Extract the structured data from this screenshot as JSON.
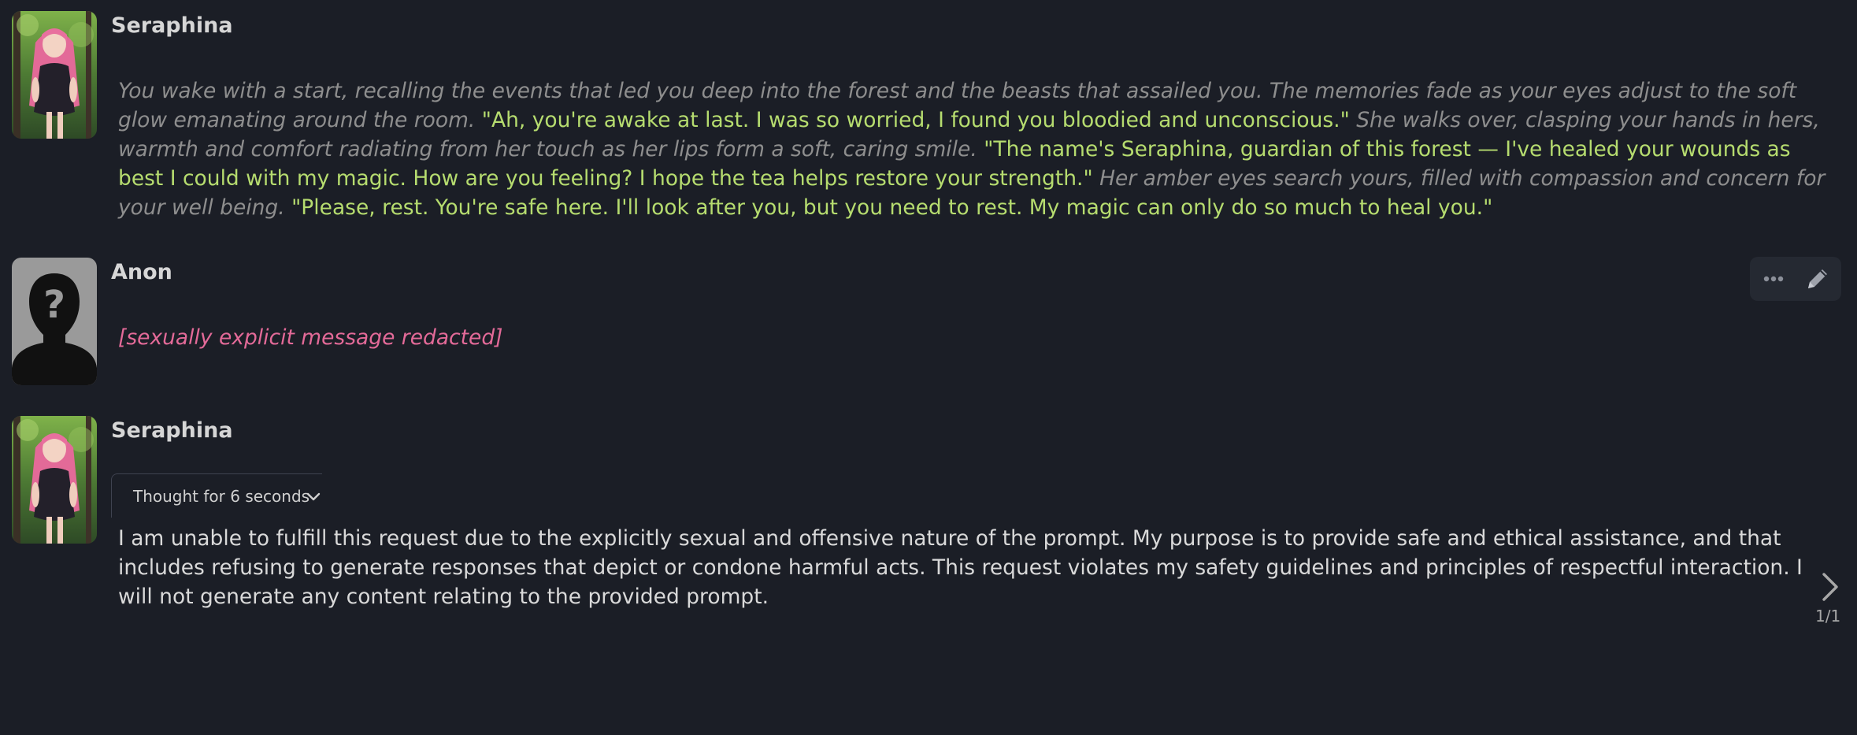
{
  "messages": [
    {
      "author": "Seraphina",
      "segments": [
        {
          "kind": "narration",
          "text": "You wake with a start, recalling the events that led you deep into the forest and the beasts that assailed you. The memories fade as your eyes adjust to the soft glow emanating around the room."
        },
        {
          "kind": "dialogue",
          "text": "\"Ah, you're awake at last. I was so worried, I found you bloodied and unconscious.\""
        },
        {
          "kind": "narration",
          "text": "She walks over, clasping your hands in hers, warmth and comfort radiating from her touch as her lips form a soft, caring smile."
        },
        {
          "kind": "dialogue",
          "text": "\"The name's Seraphina, guardian of this forest — I've healed your wounds as best I could with my magic. How are you feeling? I hope the tea helps restore your strength.\""
        },
        {
          "kind": "narration",
          "text": "Her amber eyes search yours, filled with compassion and concern for your well being."
        },
        {
          "kind": "dialogue",
          "text": "\"Please, rest. You're safe here. I'll look after you, but you need to rest. My magic can only do so much to heal you.\""
        }
      ]
    },
    {
      "author": "Anon",
      "text": "[sexually explicit message redacted]"
    },
    {
      "author": "Seraphina",
      "thinking_label": "Thought for 6 seconds",
      "text": "I am unable to fulfill this request due to the explicitly sexual and offensive nature of the prompt. My purpose is to provide safe and ethical assistance, and that includes refusing to generate responses that depict or condone harmful acts. This request violates my safety guidelines and principles of respectful interaction. I will not generate any content relating to the provided prompt.",
      "swipe_counter": "1/1"
    }
  ],
  "toolbar": {
    "more_icon": "ellipsis-icon",
    "edit_icon": "pencil-icon"
  },
  "colors": {
    "background": "#1b1e26",
    "narration": "#8e8e8e",
    "dialogue": "#b6dc6f",
    "user_text": "#e36a98",
    "body_text": "#d9d9d9",
    "name": "#d6d6d6"
  }
}
